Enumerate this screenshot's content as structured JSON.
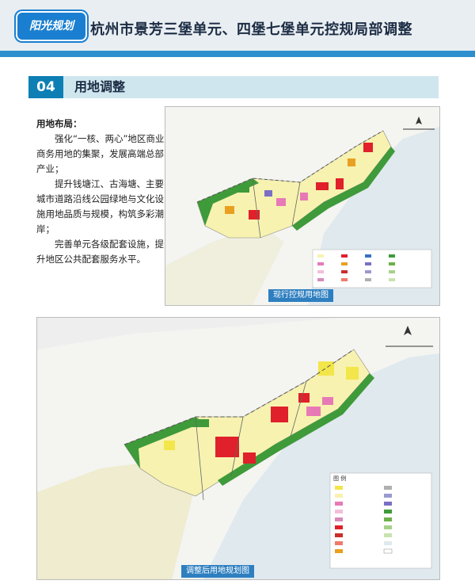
{
  "header": {
    "logo_text": "阳光规划",
    "title": "杭州市景芳三堡单元、四堡七堡单元控规局部调整"
  },
  "section": {
    "number": "04",
    "title": "用地调整"
  },
  "content": {
    "heading": "用地布局：",
    "paragraphs": [
      "强化“一核、两心”地区商业商务用地的集聚，发展高端总部产业；",
      "提升钱塘江、古海塘、主要城市道路沿线公园绿地与文化设施用地品质与规模，构筑多彩潮岸；",
      "完善单元各级配套设施，提升地区公共配套服务水平。"
    ]
  },
  "maps": {
    "current": {
      "caption": "现行控规用地图"
    },
    "adjusted": {
      "caption": "调整后用地规划图",
      "legend_title": "图 例"
    }
  },
  "colors": {
    "accent": "#0d7fb5",
    "header_stripe": "#2e8fcf",
    "river": "#dfe9ee",
    "residential": "#f7f2b0",
    "commercial": "#e0202a",
    "green": "#3f9a3a",
    "education": "#e77ab6"
  }
}
